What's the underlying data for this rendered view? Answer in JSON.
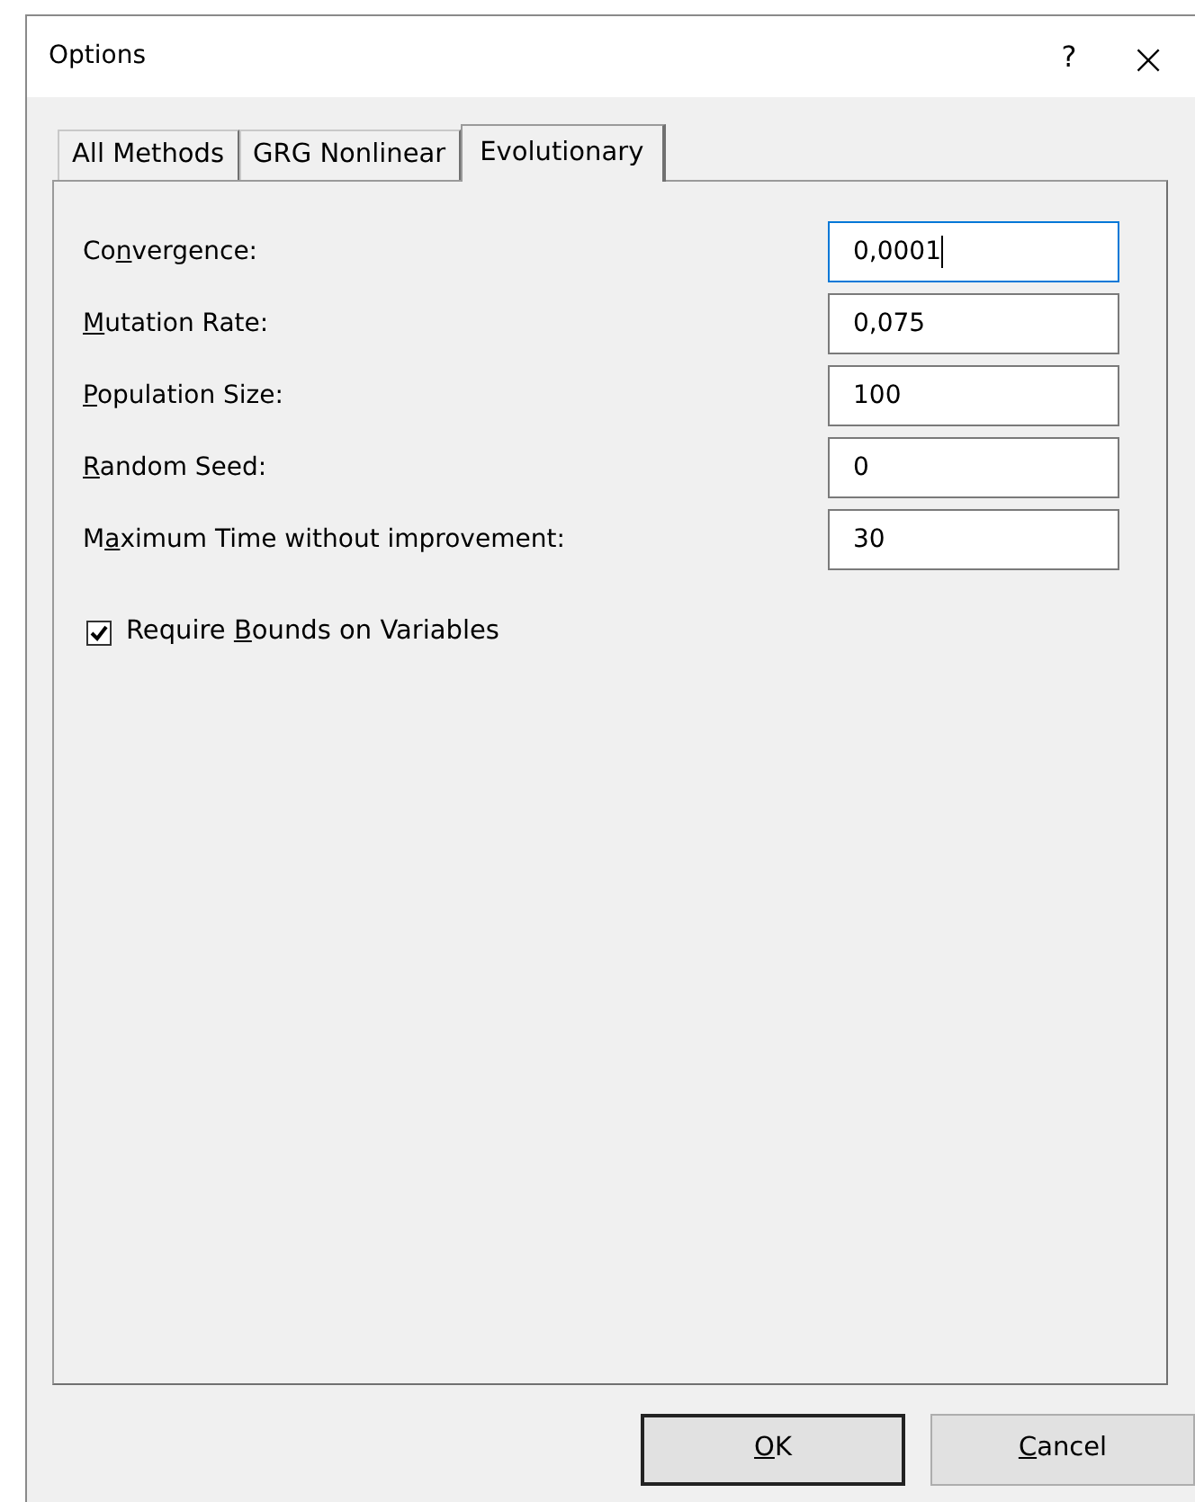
{
  "window": {
    "title": "Options",
    "help": "?",
    "close": "×"
  },
  "tabs": [
    {
      "label": "All Methods",
      "selected": false
    },
    {
      "label": "GRG Nonlinear",
      "selected": false
    },
    {
      "label": "Evolutionary",
      "selected": true
    }
  ],
  "fields": [
    {
      "label": {
        "before": "Co",
        "key": "n",
        "after": "vergence:"
      },
      "value": "0,0001",
      "focused": true
    },
    {
      "label": {
        "key": "M",
        "after": "utation Rate:"
      },
      "value": "0,075",
      "focused": false
    },
    {
      "label": {
        "key": "P",
        "after": "opulation Size:"
      },
      "value": "100",
      "focused": false
    },
    {
      "label": {
        "key": "R",
        "after": "andom Seed:"
      },
      "value": "0",
      "focused": false
    },
    {
      "label": {
        "before": "M",
        "key": "a",
        "after": "ximum Time without improvement:"
      },
      "value": "30",
      "focused": false
    }
  ],
  "checkbox": {
    "label": {
      "before": "Require ",
      "key": "B",
      "after": "ounds on Variables"
    },
    "checked": true
  },
  "buttons": [
    {
      "label": {
        "key": "O",
        "after": "K"
      },
      "default": true
    },
    {
      "label": {
        "key": "C",
        "after": "ancel"
      },
      "default": false
    }
  ]
}
